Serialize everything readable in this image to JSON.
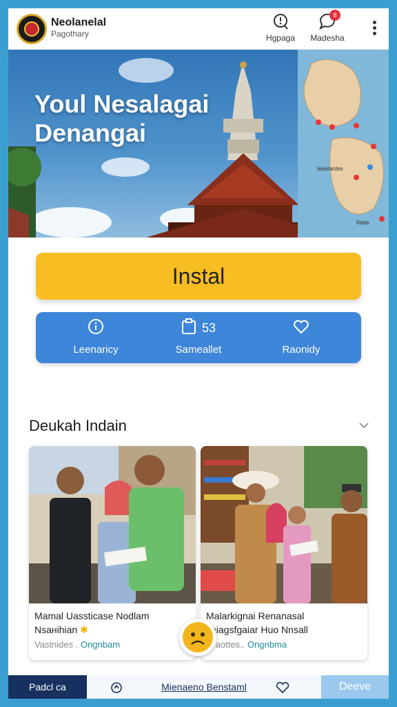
{
  "header": {
    "brand_title": "Neolanelal",
    "brand_subtitle": "Pagothary",
    "actions": [
      {
        "label": "Hgpaga",
        "icon": "search-icon"
      },
      {
        "label": "Madesha",
        "icon": "chat-icon",
        "badge": "8"
      }
    ],
    "menu_icon": "more-vertical-icon"
  },
  "hero": {
    "title_line1": "Youl Nesalagai",
    "title_line2": "Denangai",
    "map_labels": [
      "lelaslantes",
      "lfalas"
    ]
  },
  "install": {
    "label": "Instal"
  },
  "stats": [
    {
      "icon": "info-icon",
      "value": "",
      "label": "Leenaricy"
    },
    {
      "icon": "clipboard-icon",
      "value": "53",
      "label": "Sameallet"
    },
    {
      "icon": "heart-icon",
      "value": "",
      "label": "Raonidy"
    }
  ],
  "section": {
    "title": "Deukah Indain",
    "chevron_icon": "chevron-down-icon"
  },
  "cards": [
    {
      "title_line1": "Mamal Uassticase Nodlam",
      "title_line2": "Nsaнihian",
      "meta_plain": "Vastnides . ",
      "meta_accent": "Ongnbam"
    },
    {
      "title_line1": "Malarkignai Renanasal",
      "title_line2": "tiaiagsfgaiar Huo Nnsall",
      "meta_plain": "Draottes.. ",
      "meta_accent": "Ongnbma"
    }
  ],
  "bottom_bar": {
    "left_label": "Padcl ca",
    "center_label": "Mienaeno Benstaml",
    "right_label": "Deeve"
  },
  "colors": {
    "page_bg": "#3a9fd0",
    "install": "#f7bd22",
    "stats_bar": "#3e86d9",
    "bottom_bar": "#1c3a78",
    "accent_text": "#1d8a9a"
  }
}
